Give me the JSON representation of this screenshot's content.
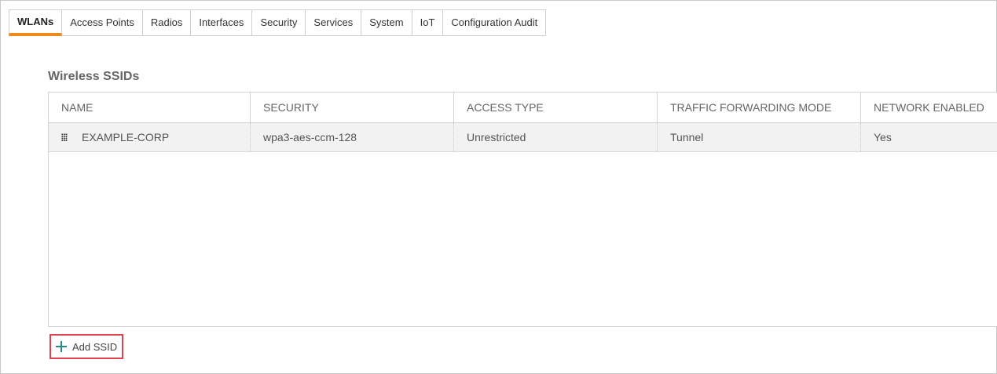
{
  "tabs": [
    {
      "label": "WLANs",
      "active": true
    },
    {
      "label": "Access Points",
      "active": false
    },
    {
      "label": "Radios",
      "active": false
    },
    {
      "label": "Interfaces",
      "active": false
    },
    {
      "label": "Security",
      "active": false
    },
    {
      "label": "Services",
      "active": false
    },
    {
      "label": "System",
      "active": false
    },
    {
      "label": "IoT",
      "active": false
    },
    {
      "label": "Configuration Audit",
      "active": false
    }
  ],
  "section": {
    "title": "Wireless SSIDs"
  },
  "table": {
    "columns": [
      "NAME",
      "SECURITY",
      "ACCESS TYPE",
      "TRAFFIC FORWARDING MODE",
      "NETWORK ENABLED"
    ],
    "rows": [
      [
        "EXAMPLE-CORP",
        "wpa3-aes-ccm-128",
        "Unrestricted",
        "Tunnel",
        "Yes"
      ]
    ]
  },
  "actions": {
    "add_ssid_label": "Add SSID"
  },
  "colors": {
    "active_tab_underline": "#f08a1c",
    "add_button_highlight": "#e0434b",
    "plus_icon": "#2a8a84"
  },
  "icons": {
    "drag_handle": "drag-handle-icon",
    "add": "plus-icon"
  }
}
